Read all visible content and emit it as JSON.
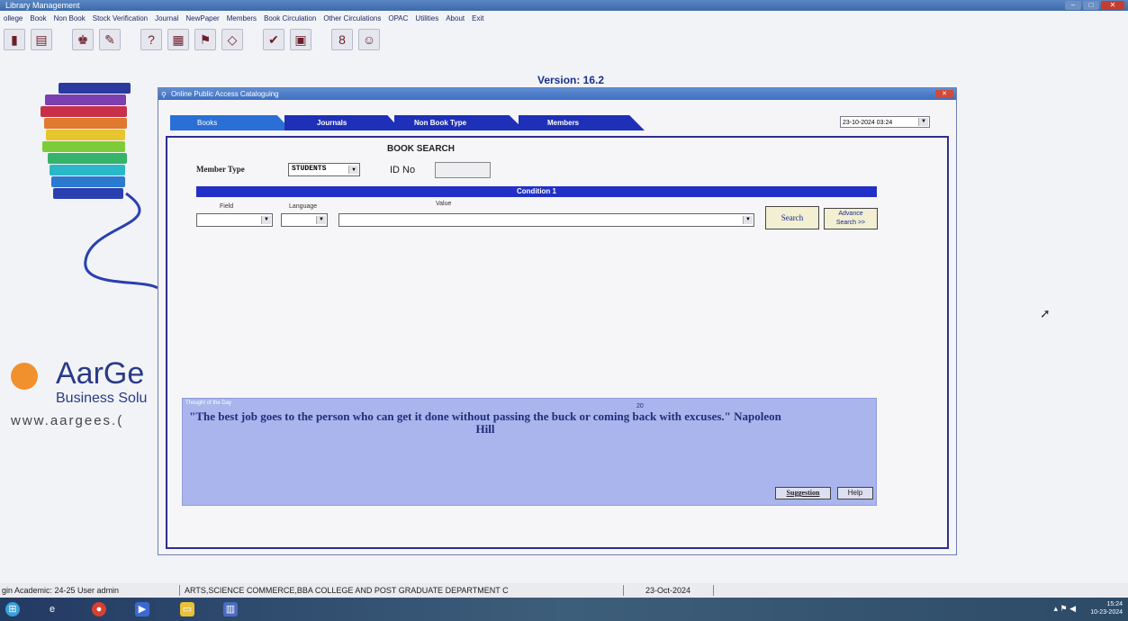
{
  "window": {
    "title": "Library Management"
  },
  "menu": [
    "ollege",
    "Book",
    "Non Book",
    "Stock Verification",
    "Journal",
    "NewPaper",
    "Members",
    "Book Circulation",
    "Other Circulations",
    "OPAC",
    "Utilities",
    "About",
    "Exit"
  ],
  "toolbar_icons": [
    "books-icon",
    "list-icon",
    "member-icon",
    "journal-icon",
    "help-person-icon",
    "catalog-icon",
    "flag-icon",
    "book-open-icon",
    "wrench-icon",
    "report-icon",
    "id-card-icon",
    "user-icon"
  ],
  "version": "Version: 16.2",
  "brand": {
    "name": "AarGe",
    "subtitle": "Business Solu",
    "url": "www.aargees.("
  },
  "dialog": {
    "title": "Online Public Access Cataloguing",
    "tabs": [
      "Books",
      "Journals",
      "Non Book Type",
      "Members"
    ],
    "date_value": "23-10-2024 03:24",
    "heading": "BOOK SEARCH",
    "member_type_label": "Member Type",
    "member_type_value": "STUDENTS",
    "id_label": "ID No",
    "condition_label": "Condition 1",
    "field_label": "Field",
    "language_label": "Language",
    "value_label": "Value",
    "search_button": "Search",
    "advance_button_line1": "Advance",
    "advance_button_line2": "Search >>",
    "thought_title": "Thought of the Day",
    "thought_number": "20",
    "quote": "\"The best job goes to the person who can get it done without passing the buck or coming back with excuses.\" Napoleon Hill",
    "suggestion_button": "Suggestion",
    "help_button": "Help"
  },
  "status": {
    "login": "gin Academic: 24-25  User admin",
    "college": "ARTS,SCIENCE COMMERCE,BBA COLLEGE AND  POST GRADUATE DEPARTMENT  C",
    "date": "23-Oct-2024"
  },
  "tray": {
    "time": "15:24",
    "date": "10-23-2024"
  }
}
